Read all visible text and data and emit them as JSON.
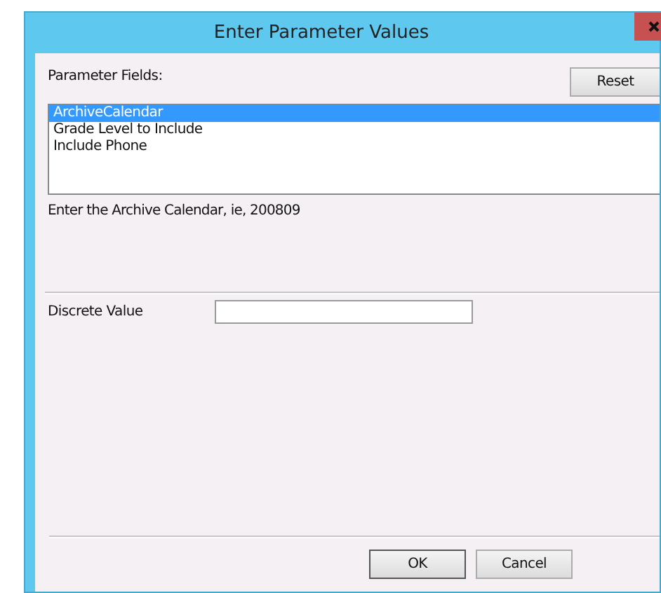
{
  "window": {
    "title": "Enter Parameter Values"
  },
  "parameter_fields": {
    "label": "Parameter Fields:",
    "reset_button": "Reset",
    "items": [
      {
        "label": "ArchiveCalendar",
        "selected": true
      },
      {
        "label": "Grade Level to Include",
        "selected": false
      },
      {
        "label": "Include Phone",
        "selected": false
      }
    ],
    "hint": "Enter the Archive Calendar, ie, 200809"
  },
  "discrete_value": {
    "label": "Discrete Value"
  },
  "buttons": [
    "OK",
    "Cancel"
  ]
}
